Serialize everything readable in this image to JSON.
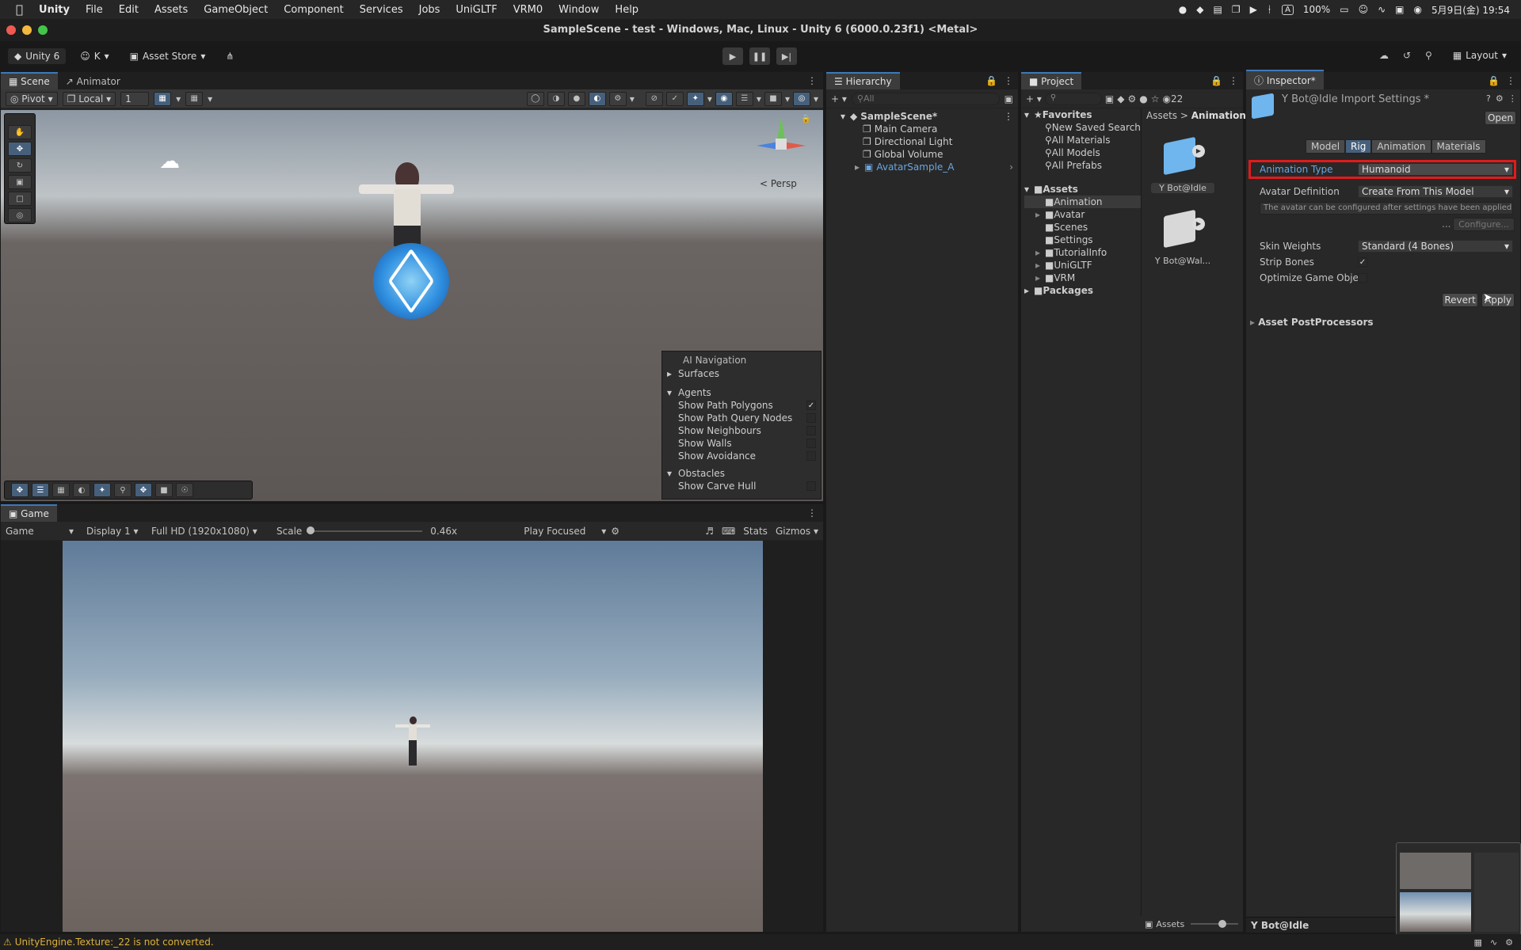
{
  "macbar": {
    "app_name": "Unity",
    "menus": [
      "File",
      "Edit",
      "Assets",
      "GameObject",
      "Component",
      "Services",
      "Jobs",
      "UniGLTF",
      "VRM0",
      "Window",
      "Help"
    ],
    "battery": "100%",
    "datetime": "5月9日(金)  19:54",
    "input_indicator": "A"
  },
  "window": {
    "title": "SampleScene - test - Windows, Mac, Linux - Unity 6 (6000.0.23f1) <Metal>"
  },
  "toolbar": {
    "unity_label": "Unity 6",
    "account_label": "K",
    "asset_store_label": "Asset Store",
    "layout_label": "Layout"
  },
  "scene": {
    "tabs": [
      "Scene",
      "Animator"
    ],
    "pivot_label": "Pivot",
    "local_label": "Local",
    "grid_value": "1",
    "persp_label": "< Persp",
    "ai_nav": {
      "title": "AI Navigation",
      "surfaces": "Surfaces",
      "agents": "Agents",
      "agent_items": [
        {
          "label": "Show Path Polygons",
          "checked": true
        },
        {
          "label": "Show Path Query Nodes",
          "checked": false
        },
        {
          "label": "Show Neighbours",
          "checked": false
        },
        {
          "label": "Show Walls",
          "checked": false
        },
        {
          "label": "Show Avoidance",
          "checked": false
        }
      ],
      "obstacles": "Obstacles",
      "obstacle_items": [
        {
          "label": "Show Carve Hull",
          "checked": false
        }
      ]
    }
  },
  "game": {
    "tab": "Game",
    "game_dropdown": "Game",
    "display": "Display 1",
    "resolution": "Full HD (1920x1080)",
    "scale_label": "Scale",
    "scale_value": "0.46x",
    "scale_fraction": 0.0,
    "play_focused": "Play Focused",
    "stats": "Stats",
    "gizmos": "Gizmos"
  },
  "hierarchy": {
    "tab": "Hierarchy",
    "search_placeholder": "All",
    "scene": "SampleScene*",
    "items": [
      "Main Camera",
      "Directional Light",
      "Global Volume",
      "AvatarSample_A"
    ]
  },
  "project": {
    "tab": "Project",
    "count": "22",
    "favorites": "Favorites",
    "fav_items": [
      "New Saved Search",
      "All Materials",
      "All Models",
      "All Prefabs"
    ],
    "assets": "Assets",
    "asset_folders": [
      "Animation",
      "Avatar",
      "Scenes",
      "Settings",
      "TutorialInfo",
      "UniGLTF",
      "VRM"
    ],
    "packages": "Packages",
    "breadcrumb": [
      "Assets",
      "Animation"
    ],
    "files": [
      "Y Bot@Idle",
      "Y Bot@Wal..."
    ],
    "footer": "Assets",
    "footer_slider_fraction": 0.7
  },
  "inspector": {
    "tab": "Inspector*",
    "title": "Y Bot@Idle Import Settings *",
    "open_button": "Open",
    "tabs": [
      "Model",
      "Rig",
      "Animation",
      "Materials"
    ],
    "active_tab": "Rig",
    "animation_type_label": "Animation Type",
    "animation_type_value": "Humanoid",
    "avatar_def_label": "Avatar Definition",
    "avatar_def_value": "Create From This Model",
    "help_text": "The avatar can be configured after settings have been applied.",
    "ellipsis": "...",
    "configure_button": "Configure...",
    "skin_weights_label": "Skin Weights",
    "skin_weights_value": "Standard (4 Bones)",
    "strip_bones_label": "Strip Bones",
    "strip_bones_checked": true,
    "optimize_label": "Optimize Game Objects",
    "optimize_checked": false,
    "revert_button": "Revert",
    "apply_button": "Apply",
    "postprocessors": "Asset PostProcessors",
    "footer_title": "Y Bot@Idle",
    "highlight_color": "#e01b1b"
  },
  "status": {
    "message": "UnityEngine.Texture:_22 is not converted."
  },
  "colors": {
    "accent": "#3a79bb",
    "selected": "#2c5d87",
    "warning": "#e0b23a"
  }
}
